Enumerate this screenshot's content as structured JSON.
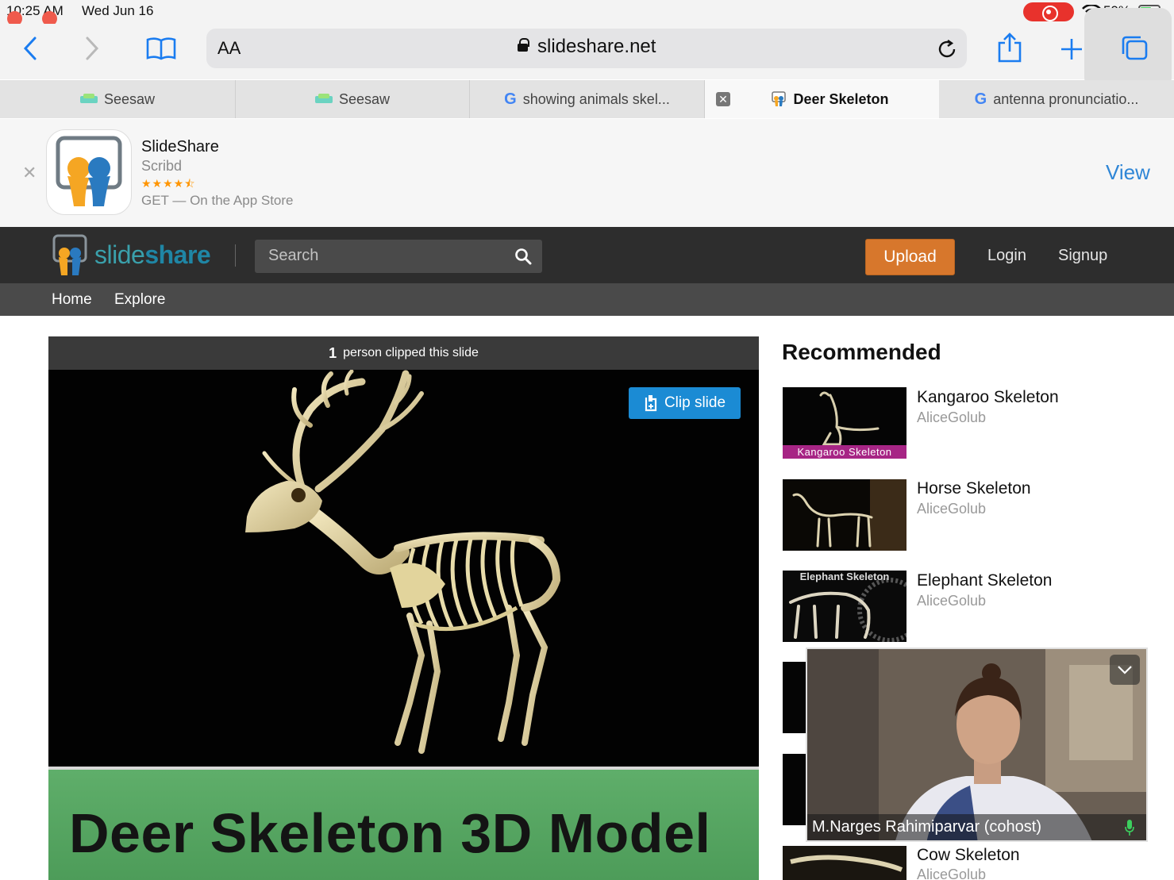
{
  "status_bar": {
    "time": "10:25 AM",
    "date": "Wed Jun 16",
    "battery": "59%",
    "battery_level": 0.59
  },
  "browser": {
    "text_size_label": "AA",
    "url": "slideshare.net",
    "tabs": [
      {
        "title": "Seesaw",
        "icon": "seesaw-favicon"
      },
      {
        "title": "Seesaw",
        "icon": "seesaw-favicon"
      },
      {
        "title": "showing animals skel...",
        "icon": "google-favicon"
      },
      {
        "title": "Deer Skeleton",
        "icon": "slideshare-favicon",
        "active": true
      },
      {
        "title": "antenna pronunciatio...",
        "icon": "google-favicon"
      }
    ]
  },
  "app_banner": {
    "name": "SlideShare",
    "developer": "Scribd",
    "rating_stars": "★★★★⯪",
    "rating": 4.5,
    "cta_text": "GET — On the App Store",
    "view_label": "View"
  },
  "site": {
    "logo_part1": "slide",
    "logo_part2": "share",
    "search_placeholder": "Search",
    "upload_label": "Upload",
    "login_label": "Login",
    "signup_label": "Signup",
    "nav": {
      "home": "Home",
      "explore": "Explore"
    }
  },
  "slide": {
    "clip_count": "1",
    "clip_text": "person clipped this slide",
    "clip_button": "Clip slide",
    "next_slide_title": "Deer Skeleton 3D Model"
  },
  "recommended": {
    "heading": "Recommended",
    "items": [
      {
        "title": "Kangaroo Skeleton",
        "author": "AliceGolub",
        "thumb_caption": "Kangaroo Skeleton"
      },
      {
        "title": "Horse Skeleton",
        "author": "AliceGolub"
      },
      {
        "title": "Elephant Skeleton",
        "author": "AliceGolub",
        "thumb_caption": "Elephant Skeleton"
      },
      {
        "title": "Cow Skeleton",
        "author": "AliceGolub"
      }
    ]
  },
  "video_call": {
    "participant": "M.Narges Rahimiparvar (cohost)"
  },
  "colors": {
    "link_blue": "#2f86d6",
    "upload_orange": "#d7772c",
    "clip_blue": "#1b8bd4",
    "header_dark": "#2d2d2d",
    "nav_gray": "#4a4a4a",
    "recording_red": "#e8322c"
  }
}
